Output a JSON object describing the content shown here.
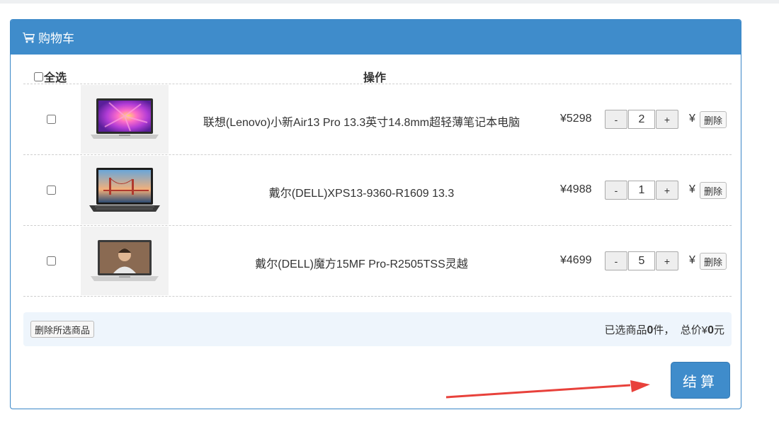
{
  "cart": {
    "title": "购物车",
    "select_all_label": "全选",
    "operation_header": "操作",
    "items": [
      {
        "name": "联想(Lenovo)小新Air13 Pro 13.3英寸14.8mm超轻薄笔记本电脑",
        "price": "¥5298",
        "quantity": "2",
        "subtotal": "¥",
        "delete_label": "删除",
        "minus": "-",
        "plus": "+"
      },
      {
        "name": "戴尔(DELL)XPS13-9360-R1609 13.3",
        "price": "¥4988",
        "quantity": "1",
        "subtotal": "¥",
        "delete_label": "删除",
        "minus": "-",
        "plus": "+"
      },
      {
        "name": "戴尔(DELL)魔方15MF Pro-R2505TSS灵越",
        "price": "¥4699",
        "quantity": "5",
        "subtotal": "¥",
        "delete_label": "删除",
        "minus": "-",
        "plus": "+"
      }
    ],
    "footer": {
      "delete_selected_label": "删除所选商品",
      "selected_prefix": "已选商品",
      "selected_count": "0",
      "selected_suffix": "件，",
      "total_prefix": "总价¥",
      "total_value": "0",
      "total_suffix": "元"
    },
    "checkout_label": "结算"
  },
  "colors": {
    "header_bg": "#3f8ccb",
    "annotation_arrow": "#e8413b"
  },
  "icons": {
    "header_icon": "shopping-cart-icon"
  }
}
